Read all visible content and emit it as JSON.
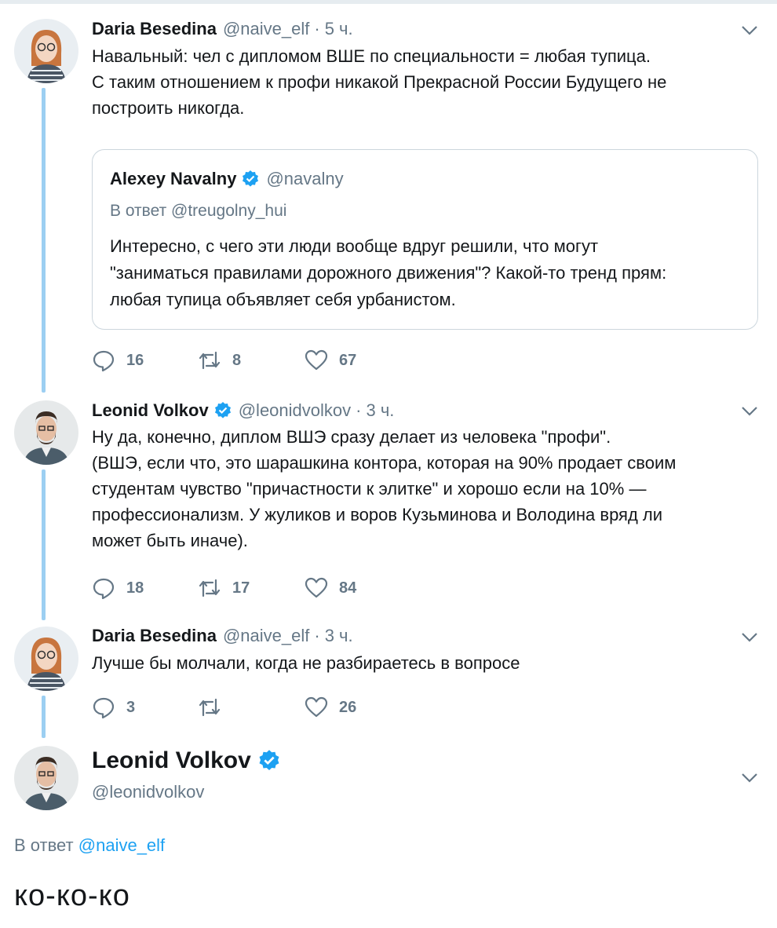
{
  "colors": {
    "accent": "#1da1f2",
    "secondary_text": "#657786",
    "thread_line": "#9ccff2"
  },
  "tweets": [
    {
      "name": "Daria Besedina",
      "handle": "@naive_elf",
      "time": "5 ч.",
      "lines": [
        "Навальный: чел с дипломом ВШЕ по специальности = любая тупица.",
        "С таким отношением к профи никакой Прекрасной России Будущего не",
        "построить никогда."
      ],
      "replies": "16",
      "retweets": "8",
      "likes": "67"
    },
    {
      "name": "Leonid Volkov",
      "handle": "@leonidvolkov",
      "time": "3 ч.",
      "lines": [
        "Ну да, конечно, диплом ВШЭ сразу делает из человека \"профи\".",
        "(ВШЭ, если что, это шарашкина контора, которая на 90% продает своим",
        "студентам чувство \"причастности к элитке\" и хорошо если на 10% —",
        "профессионализм. У жуликов и воров Кузьминова и Володина вряд ли",
        "может быть иначе)."
      ],
      "replies": "18",
      "retweets": "17",
      "likes": "84"
    },
    {
      "name": "Daria Besedina",
      "handle": "@naive_elf",
      "time": "3 ч.",
      "lines": [
        "Лучше бы молчали, когда не разбираетесь в вопросе"
      ],
      "replies": "3",
      "retweets": "",
      "likes": "26"
    }
  ],
  "quote": {
    "name": "Alexey Navalny",
    "handle": "@navalny",
    "reply_to": "В ответ @treugolny_hui",
    "lines": [
      "Интересно, с чего эти люди вообще вдруг решили, что могут",
      "\"заниматься правилами дорожного движения\"? Какой-то тренд прям:",
      "любая тупица объявляет себя урбанистом."
    ]
  },
  "main_tweet": {
    "name": "Leonid Volkov",
    "handle": "@leonidvolkov",
    "reply_prefix": "В ответ",
    "reply_handle": "@naive_elf",
    "text": "ко-ко-ко"
  },
  "icons": [
    "reply-icon",
    "retweet-icon",
    "like-icon",
    "verified-icon",
    "chevron-down-icon"
  ]
}
